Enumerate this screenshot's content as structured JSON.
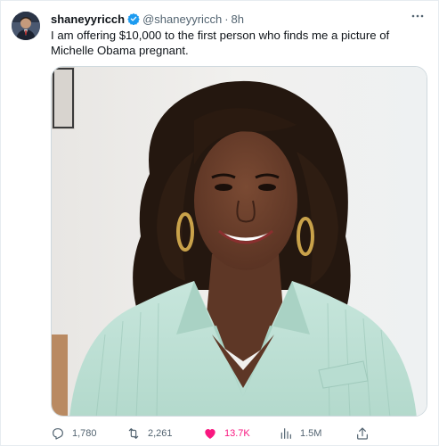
{
  "tweet": {
    "display_name": "shaneyyricch",
    "handle": "@shaneyyricch",
    "separator": "·",
    "time": "8h",
    "text": "I am offering $10,000 to the first person who finds me a picture of Michelle Obama pregnant.",
    "more_icon": "more-horizontal-icon",
    "verified_icon": "verified-badge-icon",
    "verified_color": "#1d9bf0"
  },
  "actions": {
    "replies": "1,780",
    "retweets": "2,261",
    "likes": "13.7K",
    "views": "1.5M",
    "like_color": "#f91880",
    "icons": [
      "reply-icon",
      "retweet-icon",
      "heart-icon",
      "views-icon",
      "share-icon"
    ]
  }
}
